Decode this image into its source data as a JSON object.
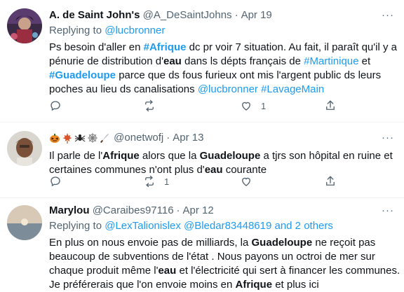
{
  "tweets": [
    {
      "name": "A. de Saint John's",
      "handle": "@A_DeSaintJohns",
      "dot": "·",
      "time": "Apr 19",
      "replying_label": "Replying to",
      "replying_to": "@lucbronner",
      "lines": [
        [
          "Ps besoin d'aller en ",
          "#Afrique",
          " dc pr voir 7 situation. Au fait, il paraît qu'il y a"
        ],
        [
          "pénurie de distribution d'",
          "eau",
          " dans ls dépts français de ",
          "#Martinique",
          " et"
        ],
        [
          "#Guadeloupe",
          " parce que ds fous furieux ont mis l'argent public ds leurs"
        ],
        [
          "poches au lieu ds canalisations ",
          "@lucbronner",
          " ",
          "#LavageMain"
        ]
      ],
      "like_count": "1"
    },
    {
      "name": "",
      "handle": "@onetwofj",
      "dot": "·",
      "time": "Apr 13",
      "emojis": [
        "pumpkin-emoji",
        "maple-leaf-emoji",
        "spider-emoji",
        "spider-web-emoji",
        "knife-emoji"
      ],
      "lines": [
        [
          "Il parle de l'",
          "Afrique",
          " alors que la ",
          "Guadeloupe",
          " a tjrs son hôpital en ruine et"
        ],
        [
          "certaines communes n'ont plus d'",
          "eau",
          " courante"
        ]
      ],
      "retweet_count": "1"
    },
    {
      "name": "Marylou",
      "handle": "@Caraibes97116",
      "dot": "·",
      "time": "Apr 12",
      "replying_label": "Replying to",
      "replying_to": "@LexTalionislex @Bledar83448619 and 2 others",
      "lines": [
        [
          "En plus on nous envoie pas de milliards, la ",
          "Guadeloupe",
          " ne reçoit pas"
        ],
        [
          "beaucoup de subventions de l'état . Nous payons un octroi de mer sur"
        ],
        [
          "chaque produit même l'",
          "eau",
          " et l'électricité qui sert à financer les communes."
        ],
        [
          "Je préférerais que l'on envoie moins en ",
          "Afrique",
          " et plus ici"
        ]
      ]
    }
  ],
  "more_symbol": "···",
  "colors": {
    "accent": "#1d9bf0",
    "muted": "#536471",
    "text": "#0f1419",
    "like": "#536471"
  }
}
